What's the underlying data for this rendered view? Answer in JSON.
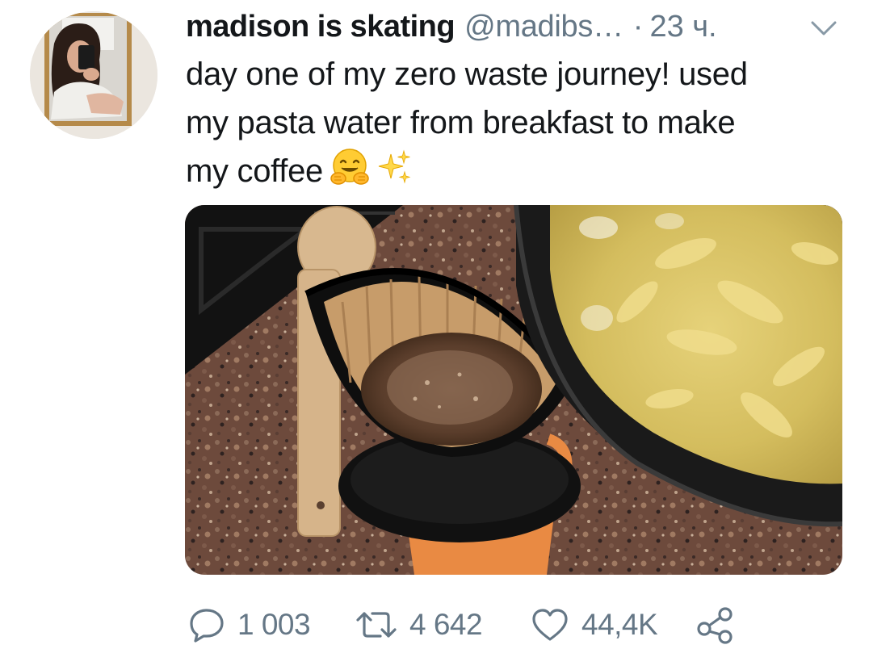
{
  "tweet": {
    "author": {
      "display_name": "madison is skating",
      "handle": "@madibs…"
    },
    "separator": "·",
    "timestamp": "23 ч.",
    "text_line_1": "day one of my zero waste journey! used",
    "text_line_2": "my pasta water from breakfast to make",
    "text_line_3": "my coffee",
    "emojis": [
      "hugging-face-icon",
      "sparkles-icon"
    ],
    "actions": {
      "reply_count": "1 003",
      "retweet_count": "4 642",
      "like_count": "44,4K"
    }
  },
  "colors": {
    "text": "#14171a",
    "secondary": "#657786",
    "background": "#ffffff"
  }
}
